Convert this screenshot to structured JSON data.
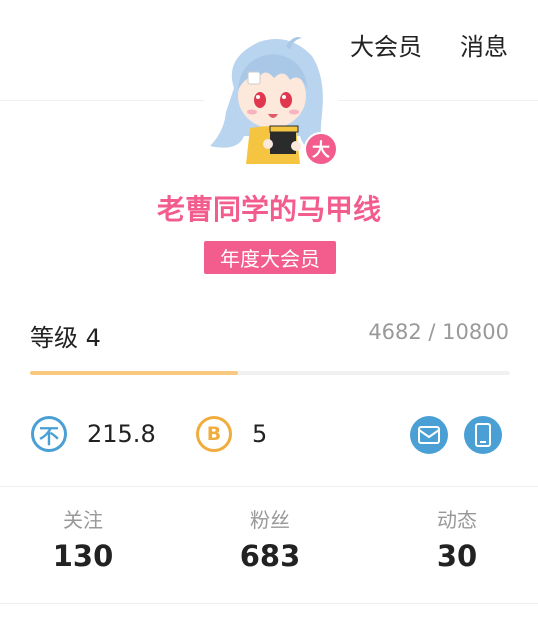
{
  "topbar": {
    "vip_link": "大会员",
    "messages_link": "消息"
  },
  "profile": {
    "username": "老曹同学的马甲线",
    "vip_badge_char": "大",
    "vip_tag": "年度大会员"
  },
  "level": {
    "label": "等级 4",
    "exp_text": "4682 / 10800",
    "progress_fraction": 0.433
  },
  "wallet": {
    "ycoin_symbol": "不",
    "ycoin_value": "215.8",
    "bcoin_symbol": "B",
    "bcoin_value": "5"
  },
  "stats": [
    {
      "label": "关注",
      "value": "130"
    },
    {
      "label": "粉丝",
      "value": "683"
    },
    {
      "label": "动态",
      "value": "30"
    }
  ],
  "colors": {
    "pink": "#f25d8e",
    "blue": "#4aa0d4",
    "gold": "#f0ad3e",
    "progress": "#f6c97f"
  }
}
